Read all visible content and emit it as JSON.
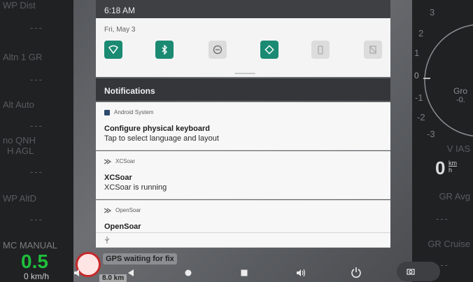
{
  "status_bar": {
    "time": "6:18 AM"
  },
  "quick_settings": {
    "date": "Fri, May 3",
    "tiles": [
      {
        "name": "wifi-icon",
        "state": "on"
      },
      {
        "name": "bluetooth-icon",
        "state": "on"
      },
      {
        "name": "do-not-disturb-icon",
        "state": "off"
      },
      {
        "name": "auto-rotate-icon",
        "state": "on"
      },
      {
        "name": "battery-saver-icon",
        "state": "off"
      },
      {
        "name": "airplane-mode-icon",
        "state": "off"
      }
    ]
  },
  "notifications": {
    "header": "Notifications",
    "items": [
      {
        "app": "Android System",
        "title": "Configure physical keyboard",
        "text": "Tap to select language and layout"
      },
      {
        "app": "XCSoar",
        "title": "XCSoar",
        "text": "XCSoar is running"
      },
      {
        "app": "OpenSoar",
        "title": "OpenSoar",
        "text": ""
      }
    ]
  },
  "left_infoboxes": [
    {
      "title": "WP Dist",
      "value": "---"
    },
    {
      "title": "Altn 1 GR",
      "value": "---"
    },
    {
      "title": "Alt Auto",
      "value": "---",
      "sub": "no QNH"
    },
    {
      "title": "H AGL",
      "value": "---"
    },
    {
      "title": "WP AltD",
      "value": "---"
    }
  ],
  "right_infoboxes": [
    {
      "title": "V IAS",
      "value": "0",
      "unit_top": "km",
      "unit_bottom": "h"
    },
    {
      "title": "GR Avg",
      "value": "---"
    },
    {
      "title": "GR Cruise",
      "value": "---"
    }
  ],
  "vario_labels": [
    "3",
    "2",
    "1",
    "0",
    "-1",
    "-2",
    "-3",
    "Gro",
    "-0."
  ],
  "bottom": {
    "mc_label": "MC MANUAL",
    "mc_value": "0.5",
    "speed": "0 km/h",
    "gps_status": "GPS waiting for fix",
    "gps_status2": "8.0 km"
  },
  "colors": {
    "accent": "#1a8a72",
    "green": "#1fbf3b",
    "warning": "#c62828"
  }
}
